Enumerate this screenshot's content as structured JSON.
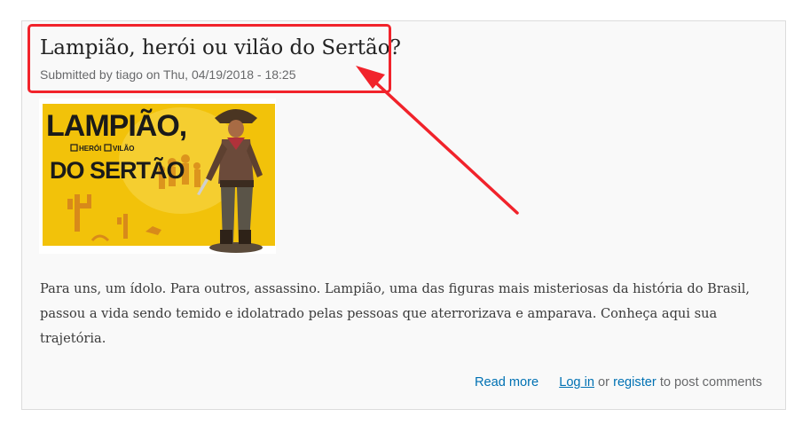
{
  "node": {
    "title": "Lampião, herói ou vilão do Sertão?",
    "submitted": "Submitted by tiago on Thu, 04/19/2018 - 18:25",
    "image": {
      "headline_line1": "LAMPIÃO,",
      "check_heroi": "HERÓI",
      "check_vilao": "VILÃO",
      "headline_line2": "DO SERTÃO"
    },
    "body": "Para uns, um ídolo. Para outros, assassino. Lampião, uma das figuras mais misteriosas da história do Brasil, passou a vida sendo temido e idolatrado pelas pessoas que aterrorizava e amparava. Conheça aqui sua trajetória.",
    "links": {
      "read_more": "Read more",
      "log_in": "Log in",
      "or": "or",
      "register": "register",
      "to_post": "to post comments"
    }
  },
  "colors": {
    "annotation": "#f1232b",
    "link": "#0071b3",
    "image_yellow": "#f2c20a"
  }
}
